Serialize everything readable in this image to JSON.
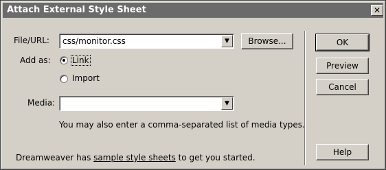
{
  "window": {
    "title": "Attach External Style Sheet",
    "close_glyph": "✕"
  },
  "file_url": {
    "label": "File/URL:",
    "value": "css/monitor.css",
    "browse_label": "Browse..."
  },
  "add_as": {
    "label": "Add as:",
    "options": [
      {
        "label": "Link",
        "selected": true
      },
      {
        "label": "Import",
        "selected": false
      }
    ]
  },
  "media": {
    "label": "Media:",
    "value": "",
    "hint": "You may also enter a comma-separated list of media types."
  },
  "buttons": {
    "ok": "OK",
    "preview": "Preview",
    "cancel": "Cancel",
    "help": "Help"
  },
  "footer": {
    "prefix": "Dreamweaver has ",
    "link": "sample style sheets",
    "suffix": " to get you started."
  },
  "icons": {
    "dropdown_arrow": "chevron-down-icon"
  }
}
